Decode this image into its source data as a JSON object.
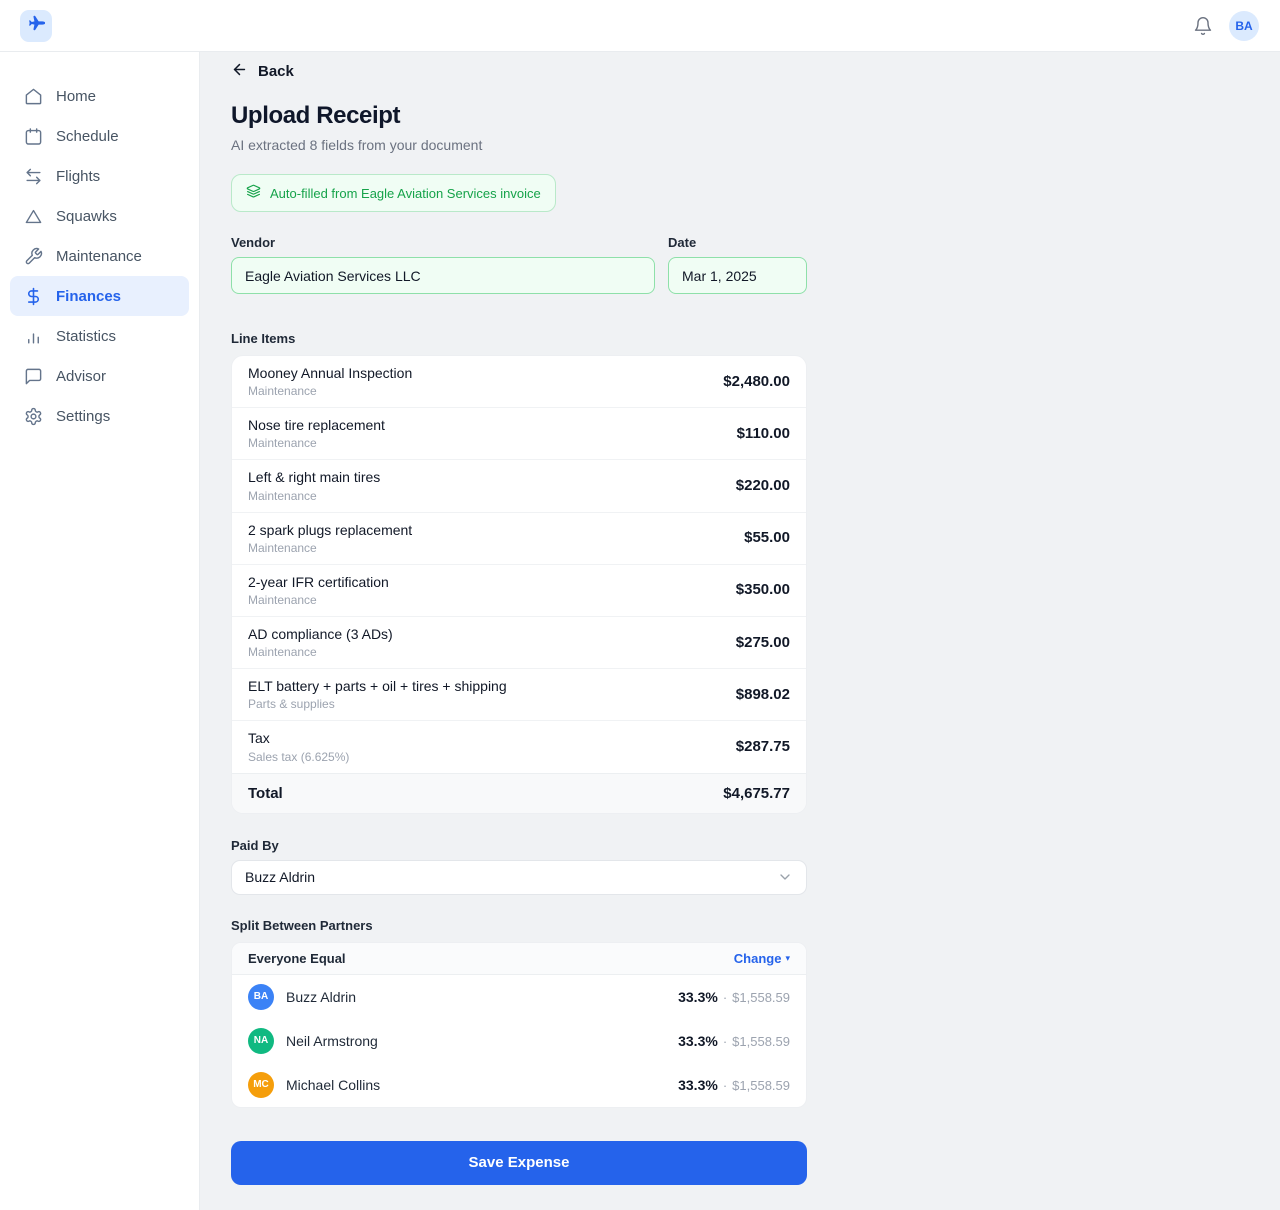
{
  "colors": {
    "brand_blue": "#2563eb",
    "accent_green": "#16a34a",
    "green_field_bg": "#f0fdf4",
    "green_field_border": "#8ee0a9",
    "page_bg": "#f0f2f4",
    "avatar_blue": "#3b82f6",
    "avatar_green": "#10b981",
    "avatar_orange": "#f59e0b"
  },
  "topbar": {
    "logo_icon": "plane-icon",
    "bell_icon": "bell-icon",
    "avatar_initials": "BA"
  },
  "sidebar": {
    "items": [
      {
        "label": "Home",
        "icon": "home-icon",
        "active": false
      },
      {
        "label": "Schedule",
        "icon": "calendar-icon",
        "active": false
      },
      {
        "label": "Flights",
        "icon": "transfer-arrows-icon",
        "active": false
      },
      {
        "label": "Squawks",
        "icon": "triangle-icon",
        "active": false
      },
      {
        "label": "Maintenance",
        "icon": "wrench-icon",
        "active": false
      },
      {
        "label": "Finances",
        "icon": "dollar-icon",
        "active": true
      },
      {
        "label": "Statistics",
        "icon": "bar-chart-icon",
        "active": false
      },
      {
        "label": "Advisor",
        "icon": "chat-bubble-icon",
        "active": false
      },
      {
        "label": "Settings",
        "icon": "gear-icon",
        "active": false
      }
    ]
  },
  "page": {
    "back_label": "Back",
    "title": "Upload Receipt",
    "subtitle": "AI extracted 8 fields from your document",
    "autofill_badge": "Auto-filled from Eagle Aviation Services invoice",
    "vendor": {
      "label": "Vendor",
      "value": "Eagle Aviation Services LLC"
    },
    "date": {
      "label": "Date",
      "value": "Mar 1, 2025"
    },
    "line_items": {
      "label": "Line Items",
      "items": [
        {
          "name": "Mooney Annual Inspection",
          "category": "Maintenance",
          "amount": "$2,480.00"
        },
        {
          "name": "Nose tire replacement",
          "category": "Maintenance",
          "amount": "$110.00"
        },
        {
          "name": "Left & right main tires",
          "category": "Maintenance",
          "amount": "$220.00"
        },
        {
          "name": "2 spark plugs replacement",
          "category": "Maintenance",
          "amount": "$55.00"
        },
        {
          "name": "2-year IFR certification",
          "category": "Maintenance",
          "amount": "$350.00"
        },
        {
          "name": "AD compliance (3 ADs)",
          "category": "Maintenance",
          "amount": "$275.00"
        },
        {
          "name": "ELT battery + parts + oil + tires + shipping",
          "category": "Parts & supplies",
          "amount": "$898.02"
        },
        {
          "name": "Tax",
          "category": "Sales tax (6.625%)",
          "amount": "$287.75"
        }
      ],
      "total_label": "Total",
      "total_amount": "$4,675.77"
    },
    "paid_by": {
      "label": "Paid By",
      "value": "Buzz Aldrin"
    },
    "split": {
      "label": "Split Between Partners",
      "mode": "Everyone Equal",
      "change_label": "Change",
      "change_caret": "▾",
      "separator": "·",
      "partners": [
        {
          "initials": "BA",
          "name": "Buzz Aldrin",
          "percent": "33.3%",
          "amount": "$1,558.59",
          "avatar_color": "#3b82f6"
        },
        {
          "initials": "NA",
          "name": "Neil Armstrong",
          "percent": "33.3%",
          "amount": "$1,558.59",
          "avatar_color": "#10b981"
        },
        {
          "initials": "MC",
          "name": "Michael Collins",
          "percent": "33.3%",
          "amount": "$1,558.59",
          "avatar_color": "#f59e0b"
        }
      ]
    },
    "save_label": "Save Expense"
  }
}
